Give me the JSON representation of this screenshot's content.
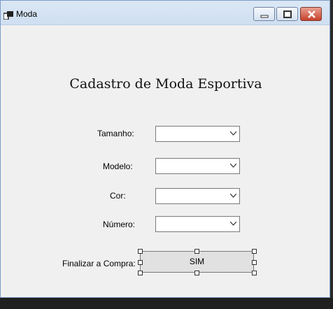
{
  "window": {
    "title": "Moda",
    "app_icon": "window-app-icon"
  },
  "controls": {
    "minimize": "minimize-icon",
    "maximize": "maximize-icon",
    "close": "close-icon"
  },
  "form": {
    "heading": "Cadastro de Moda Esportiva",
    "fields": [
      {
        "label": "Tamanho:",
        "value": ""
      },
      {
        "label": "Modelo:",
        "value": ""
      },
      {
        "label": "Cor:",
        "value": ""
      },
      {
        "label": "Número:",
        "value": ""
      }
    ],
    "finalize_label": "Finalizar a Compra:",
    "finalize_button": "SIM"
  }
}
